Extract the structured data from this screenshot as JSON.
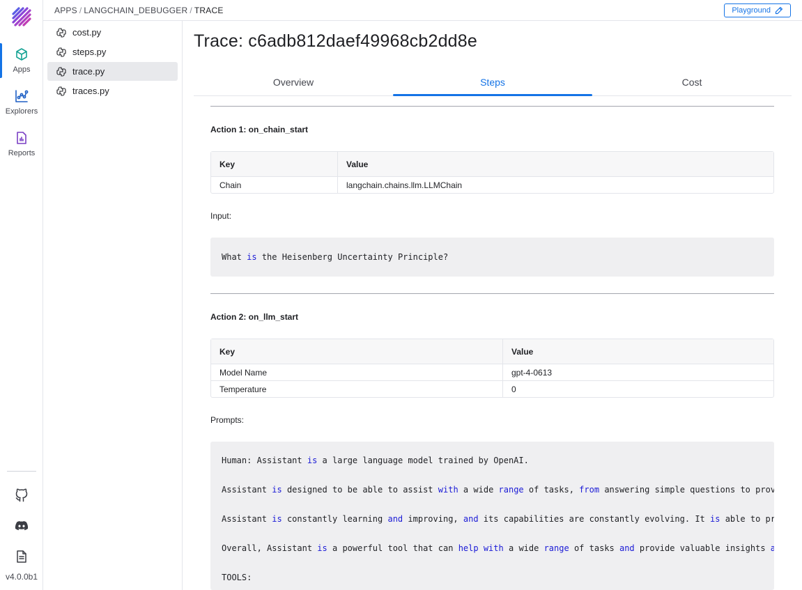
{
  "rail": {
    "items": [
      {
        "label": "Apps",
        "icon": "cube-icon"
      },
      {
        "label": "Explorers",
        "icon": "chart-icon"
      },
      {
        "label": "Reports",
        "icon": "report-icon"
      }
    ],
    "bottom_icons": [
      "github-icon",
      "discord-icon",
      "docs-icon"
    ],
    "version": "v4.0.0b1"
  },
  "breadcrumb": {
    "items": [
      "APPS",
      "LANGCHAIN_DEBUGGER",
      "TRACE"
    ]
  },
  "header": {
    "playground_label": "Playground"
  },
  "files": [
    {
      "name": "cost.py"
    },
    {
      "name": "steps.py"
    },
    {
      "name": "trace.py"
    },
    {
      "name": "traces.py"
    }
  ],
  "page": {
    "title": "Trace: c6adb812daef49968cb2dd8e",
    "tabs": [
      "Overview",
      "Steps",
      "Cost"
    ],
    "active_tab": "Steps"
  },
  "actions": [
    {
      "title": "Action 1: on_chain_start",
      "table": {
        "headers": [
          "Key",
          "Value"
        ],
        "rows": [
          [
            "Chain",
            "langchain.chains.llm.LLMChain"
          ]
        ]
      },
      "section_label": "Input:",
      "code_lines": [
        "What is the Heisenberg Uncertainty Principle?"
      ]
    },
    {
      "title": "Action 2: on_llm_start",
      "table": {
        "headers": [
          "Key",
          "Value"
        ],
        "rows": [
          [
            "Model Name",
            "gpt-4-0613"
          ],
          [
            "Temperature",
            "0"
          ]
        ]
      },
      "section_label": "Prompts:",
      "code_lines": [
        "Human: Assistant is a large language model trained by OpenAI.",
        "Assistant is designed to be able to assist with a wide range of tasks, from answering simple questions to providin",
        "Assistant is constantly learning and improving, and its capabilities are constantly evolving. It is able to proces",
        "Overall, Assistant is a powerful tool that can help with a wide range of tasks and provide valuable insights and i",
        "TOOLS:"
      ]
    }
  ],
  "colors": {
    "accent": "#1473e6",
    "keyword": "#1a1ad6",
    "code_bg": "#efeff1"
  }
}
